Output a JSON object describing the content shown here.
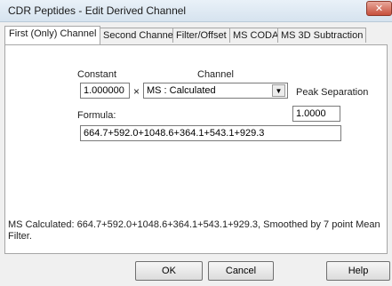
{
  "window": {
    "title": "CDR Peptides - Edit Derived Channel",
    "close_glyph": "✕"
  },
  "tabs": [
    {
      "label": "First (Only) Channel",
      "active": true
    },
    {
      "label": "Second Channel",
      "active": false
    },
    {
      "label": "Filter/Offset",
      "active": false
    },
    {
      "label": "MS CODA",
      "active": false
    },
    {
      "label": "MS 3D Subtraction",
      "active": false
    }
  ],
  "first_channel": {
    "constant_label": "Constant",
    "constant_value": "1.000000",
    "multiply_symbol": "×",
    "channel_label": "Channel",
    "channel_value": "MS : Calculated",
    "dropdown_glyph": "▼",
    "peak_separation_label": "Peak Separation",
    "peak_separation_value": "1.0000",
    "formula_label": "Formula:",
    "formula_value": "664.7+592.0+1048.6+364.1+543.1+929.3"
  },
  "status_text": "MS Calculated: 664.7+592.0+1048.6+364.1+543.1+929.3, Smoothed by 7 point Mean Filter.",
  "buttons": {
    "ok": "OK",
    "cancel": "Cancel",
    "help": "Help"
  }
}
